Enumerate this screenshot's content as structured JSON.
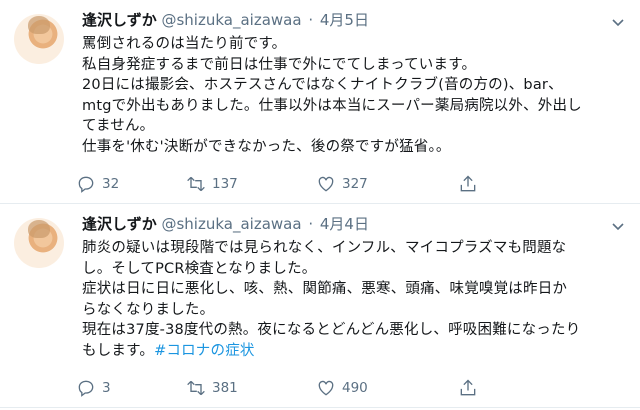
{
  "tweets": [
    {
      "display_name": "逢沢しずか",
      "handle": "@shizuka_aizawaa",
      "separator": "·",
      "date": "4月5日",
      "lines": [
        "罵倒されるのは当たり前です。",
        "私自身発症するまで前日は仕事で外にでてしまっています。",
        "20日には撮影会、ホステスさんではなくナイトクラブ(音の方の)、bar、",
        "mtgで外出もありました。仕事以外は本当にスーパー薬局病院以外、外出し",
        "てません。",
        "仕事を'休む'決断ができなかった、後の祭ですが猛省。。"
      ],
      "replies": "32",
      "retweets": "137",
      "likes": "327"
    },
    {
      "display_name": "逢沢しずか",
      "handle": "@shizuka_aizawaa",
      "separator": "·",
      "date": "4月4日",
      "lines": [
        "肺炎の疑いは現段階では見られなく、インフル、マイコプラズマも問題な",
        "し。そしてPCR検査となりました。",
        "症状は日に日に悪化し、咳、熱、関節痛、悪寒、頭痛、味覚嗅覚は昨日か",
        "らなくなりました。",
        "現在は37度-38度代の熱。夜になるとどんどん悪化し、呼吸困難になったり"
      ],
      "last_line_prefix": "もします。",
      "hashtag": "#コロナの症状",
      "replies": "3",
      "retweets": "381",
      "likes": "490"
    }
  ],
  "icons": {
    "reply": "reply-icon",
    "retweet": "retweet-icon",
    "like": "heart-icon",
    "share": "share-icon",
    "more": "chevron-down-icon"
  },
  "colors": {
    "text": "#14171a",
    "muted": "#5b7083",
    "link": "#1b95e0",
    "divider": "#e6ecf0"
  }
}
